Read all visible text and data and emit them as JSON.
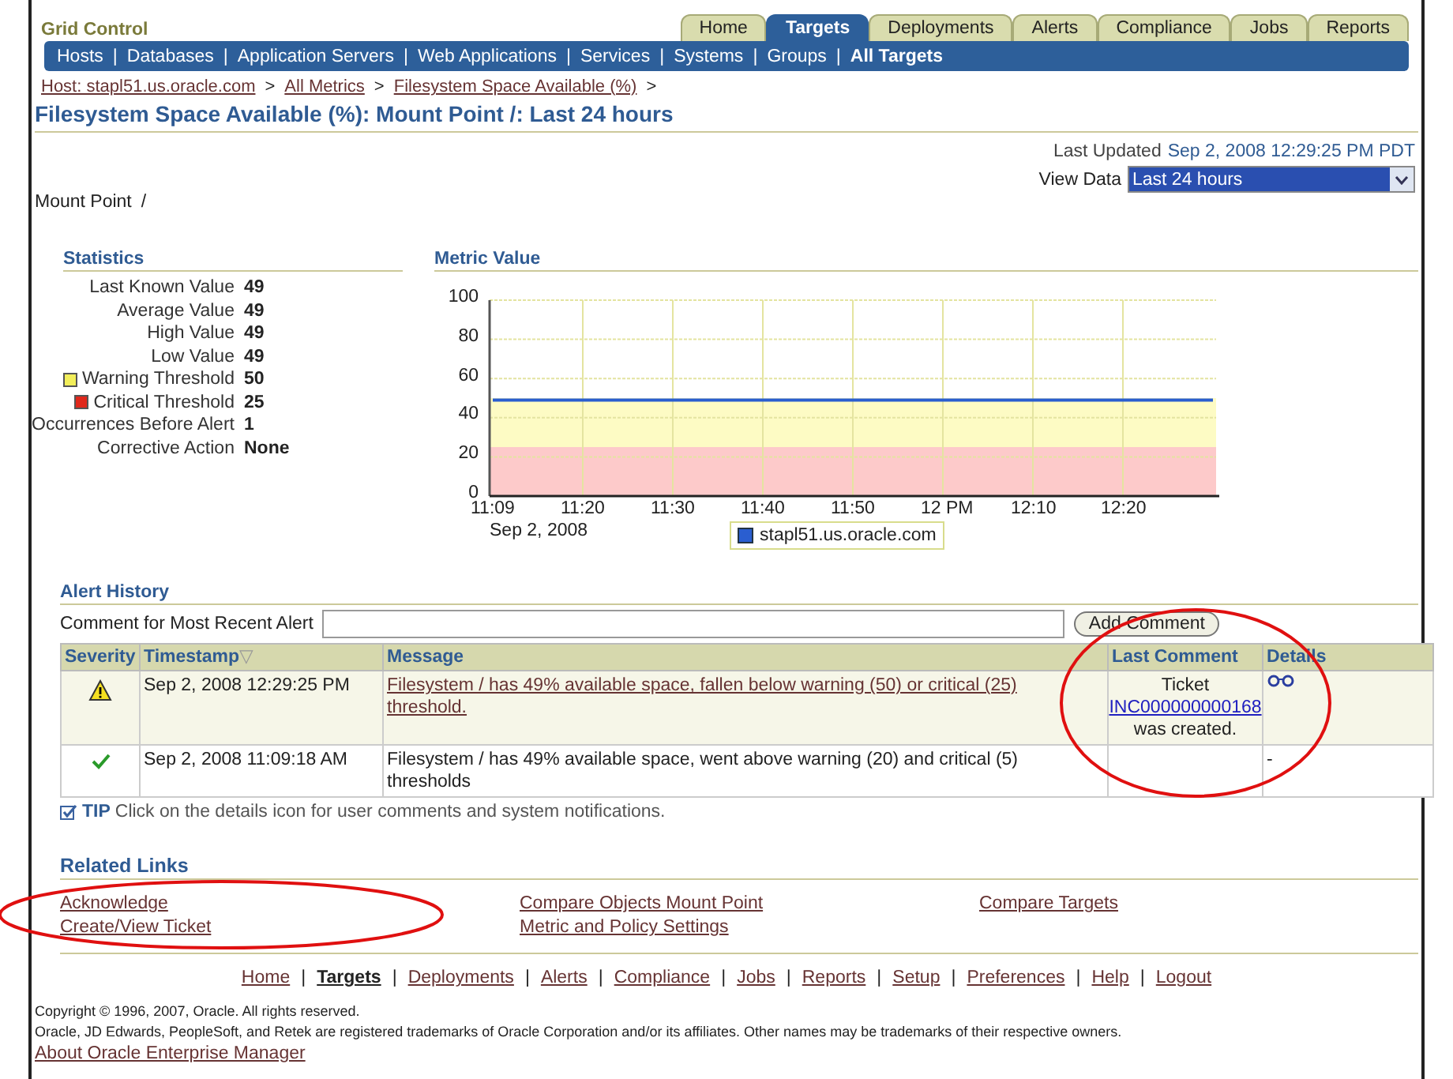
{
  "header": {
    "brand": "Grid Control",
    "tabs": [
      {
        "label": "Home",
        "selected": false
      },
      {
        "label": "Targets",
        "selected": true
      },
      {
        "label": "Deployments",
        "selected": false
      },
      {
        "label": "Alerts",
        "selected": false
      },
      {
        "label": "Compliance",
        "selected": false
      },
      {
        "label": "Jobs",
        "selected": false
      },
      {
        "label": "Reports",
        "selected": false
      }
    ],
    "separator": "|",
    "subnav": [
      {
        "label": "Hosts",
        "selected": false
      },
      {
        "label": "Databases",
        "selected": false
      },
      {
        "label": "Application Servers",
        "selected": false
      },
      {
        "label": "Web Applications",
        "selected": false
      },
      {
        "label": "Services",
        "selected": false
      },
      {
        "label": "Systems",
        "selected": false
      },
      {
        "label": "Groups",
        "selected": false
      },
      {
        "label": "All Targets",
        "selected": true
      }
    ]
  },
  "breadcrumbs": [
    "Host: stapl51.us.oracle.com",
    "All Metrics",
    "Filesystem Space Available (%)"
  ],
  "breadcrumb_separator": ">",
  "page_title": "Filesystem Space Available (%): Mount Point /: Last 24 hours",
  "last_updated": {
    "label": "Last Updated",
    "value": "Sep 2, 2008 12:29:25 PM PDT"
  },
  "view_data": {
    "label": "View Data",
    "value": "Last 24 hours"
  },
  "mount_point": {
    "label": "Mount Point",
    "value": "/"
  },
  "statistics": {
    "title": "Statistics",
    "rows": [
      {
        "label": "Last Known Value",
        "value": "49"
      },
      {
        "label": "Average Value",
        "value": "49"
      },
      {
        "label": "High Value",
        "value": "49"
      },
      {
        "label": "Low Value",
        "value": "49"
      },
      {
        "label": "Warning Threshold",
        "value": "50",
        "color": "#f2ee5a"
      },
      {
        "label": "Critical Threshold",
        "value": "25",
        "color": "#e0281b"
      },
      {
        "label": "Occurrences Before Alert",
        "value": "1"
      },
      {
        "label": "Corrective Action",
        "value": "None"
      }
    ]
  },
  "metric": {
    "title": "Metric Value",
    "chart_data": {
      "type": "line",
      "xlabel": "Sep 2, 2008",
      "categories": [
        "11:09",
        "11:20",
        "11:30",
        "11:40",
        "11:50",
        "12 PM",
        "12:10",
        "12:20",
        null
      ],
      "series": [
        {
          "name": "stapl51.us.oracle.com",
          "color": "#2a5ed0",
          "values": [
            49,
            49,
            49,
            49,
            49,
            49,
            49,
            49,
            49
          ]
        }
      ],
      "ylim": [
        0,
        100
      ],
      "yticks": [
        0,
        20,
        40,
        60,
        80,
        100
      ],
      "grid": true,
      "bands": [
        {
          "axis": "y",
          "from": 25,
          "to": 50,
          "color": "#fdfbc4"
        },
        {
          "axis": "y",
          "from": 0,
          "to": 25,
          "color": "#fdcaca"
        }
      ]
    }
  },
  "alert_history": {
    "title": "Alert History",
    "comment_label": "Comment for Most Recent Alert",
    "add_button": "Add Comment",
    "columns": [
      {
        "label": "Severity"
      },
      {
        "label": "Timestamp",
        "sort": "▽"
      },
      {
        "label": "Message"
      },
      {
        "label": "Last Comment"
      },
      {
        "label": "Details"
      }
    ],
    "rows": [
      {
        "severity": {
          "kind": "warning"
        },
        "timestamp": "Sep 2, 2008 12:29:25 PM",
        "message": "Filesystem / has 49% available space, fallen below warning (50) or critical (25) threshold.",
        "message_link": true,
        "comment": [
          "Ticket",
          "INC000000000168",
          "was created."
        ],
        "details": {
          "kind": "icon"
        }
      },
      {
        "severity": {
          "kind": "clear"
        },
        "timestamp": "Sep 2, 2008 11:09:18 AM",
        "message": "Filesystem / has 49% available space, went above warning (20) and critical (5) thresholds",
        "message_link": false,
        "comment": [],
        "details": {
          "kind": "text",
          "text": "-"
        }
      }
    ]
  },
  "tip": {
    "label": "TIP",
    "text": "Click on the details icon for user comments and system notifications."
  },
  "related_links": {
    "title": "Related Links",
    "columns": [
      [
        "Acknowledge",
        "Create/View Ticket"
      ],
      [
        "Compare Objects Mount Point",
        "Metric and Policy Settings"
      ],
      [
        "Compare Targets"
      ]
    ]
  },
  "footer": {
    "separator": "|",
    "links": [
      {
        "label": "Home",
        "selected": false
      },
      {
        "label": "Targets",
        "selected": true
      },
      {
        "label": "Deployments",
        "selected": false
      },
      {
        "label": "Alerts",
        "selected": false
      },
      {
        "label": "Compliance",
        "selected": false
      },
      {
        "label": "Jobs",
        "selected": false
      },
      {
        "label": "Reports",
        "selected": false
      },
      {
        "label": "Setup",
        "selected": false
      },
      {
        "label": "Preferences",
        "selected": false
      },
      {
        "label": "Help",
        "selected": false
      },
      {
        "label": "Logout",
        "selected": false
      }
    ],
    "copyright": "Copyright © 1996, 2007, Oracle. All rights reserved.",
    "trademark": "Oracle, JD Edwards, PeopleSoft, and Retek are registered trademarks of Oracle Corporation and/or its affiliates. Other names may be trademarks of their respective owners.",
    "about": "About Oracle Enterprise Manager"
  }
}
